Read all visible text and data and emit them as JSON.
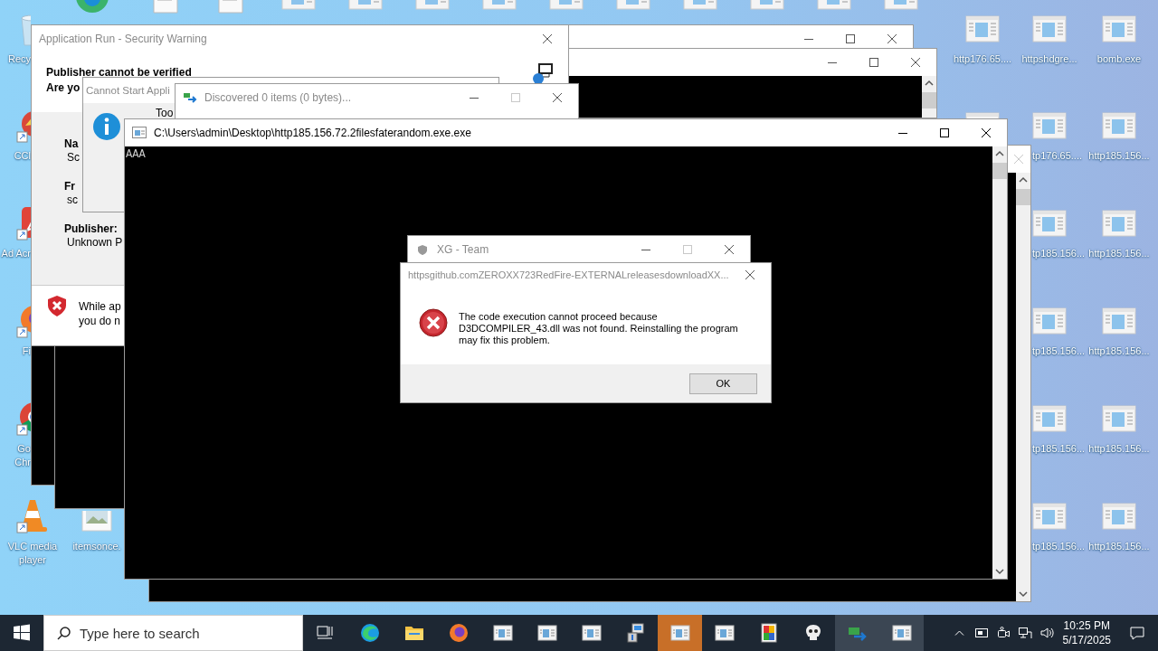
{
  "desktop": {
    "icons": [
      {
        "kind": "recycle",
        "label": "Recy"
      },
      {
        "kind": "browser"
      },
      {
        "kind": "doc"
      },
      {
        "kind": "doc"
      },
      {
        "kind": "exe"
      },
      {
        "kind": "exe"
      },
      {
        "kind": "exe"
      },
      {
        "kind": "exe"
      },
      {
        "kind": "exe"
      },
      {
        "kind": "exe"
      },
      {
        "kind": "exe"
      },
      {
        "kind": "exe"
      },
      {
        "kind": "exe"
      },
      {
        "kind": "exe"
      },
      {
        "kind": "exe",
        "label": "http176.65...."
      },
      {
        "kind": "exe",
        "label": "httpshdgre..."
      },
      {
        "kind": "exe",
        "label": "bomb.exe"
      },
      {
        "kind": "shortcut",
        "label": "CCl"
      },
      {
        "kind": "exe"
      },
      {
        "kind": "exe",
        "label": "tp176.65...."
      },
      {
        "kind": "exe",
        "label": "http185.156..."
      },
      {
        "kind": "acrobat",
        "label": "Ad Acr"
      },
      {
        "kind": "exe",
        "label": "tp185.156..."
      },
      {
        "kind": "exe",
        "label": "http185.156..."
      },
      {
        "kind": "firefox",
        "label": "Fi"
      },
      {
        "kind": "exe",
        "label": "tp185.156..."
      },
      {
        "kind": "exe",
        "label": "http185.156..."
      },
      {
        "kind": "chrome",
        "label": "Go Chr"
      },
      {
        "kind": "exe",
        "label": "tp185.156..."
      },
      {
        "kind": "exe",
        "label": "http185.156..."
      },
      {
        "kind": "vlc",
        "label": "VLC media player"
      },
      {
        "kind": "image",
        "label": "itemsonce."
      },
      {
        "kind": "exe",
        "label": "tp185.156..."
      },
      {
        "kind": "exe",
        "label": "http185.156..."
      }
    ]
  },
  "windows": [
    {
      "kind": "blank",
      "active": false,
      "buttons": [
        {
          "kind": "minimize",
          "disabled": false
        },
        {
          "kind": "maximize",
          "disabled": false
        },
        {
          "kind": "close",
          "disabled": false
        }
      ]
    },
    {
      "kind": "console",
      "active": false,
      "buttons": [
        {
          "kind": "minimize",
          "disabled": false
        },
        {
          "kind": "maximize",
          "disabled": false
        },
        {
          "kind": "close",
          "disabled": false
        }
      ]
    },
    {
      "kind": "console"
    },
    {
      "kind": "console"
    },
    {
      "kind": "security_warning",
      "title": "Application Run - Security Warning",
      "active": false,
      "buttons": [
        {
          "kind": "close",
          "disabled": false
        }
      ],
      "heading": [
        "Publisher cannot be verified",
        "Are yo"
      ],
      "fields": [
        {
          "label": "Na",
          "value": "Sc"
        },
        {
          "label": "Fr",
          "value": "sc"
        },
        {
          "label": "Publisher:",
          "value": "Unknown P"
        }
      ],
      "footer": "While ap\nyou do n"
    },
    {
      "kind": "message",
      "title": "Cannot Start Appli",
      "active": false,
      "text": "Too"
    },
    {
      "kind": "progress",
      "title": "Discovered 0 items (0 bytes)...",
      "active": false,
      "buttons": [
        {
          "kind": "minimize",
          "disabled": false
        },
        {
          "kind": "maximize",
          "disabled": true
        },
        {
          "kind": "close",
          "disabled": false
        }
      ]
    },
    {
      "kind": "console",
      "active": false,
      "buttons": [
        {
          "kind": "close",
          "disabled": true
        }
      ]
    },
    {
      "kind": "console",
      "title": "C:\\Users\\admin\\Desktop\\http185.156.72.2filesfaterandom.exe.exe",
      "active": true,
      "output": "AAA",
      "buttons": [
        {
          "kind": "minimize",
          "disabled": false
        },
        {
          "kind": "maximize",
          "disabled": false
        },
        {
          "kind": "close",
          "disabled": false
        }
      ]
    },
    {
      "kind": "titled",
      "title": "XG - Team",
      "active": false,
      "buttons": [
        {
          "kind": "minimize",
          "disabled": false
        },
        {
          "kind": "maximize",
          "disabled": true
        },
        {
          "kind": "close",
          "disabled": false
        }
      ]
    },
    {
      "kind": "error",
      "title": "httpsgithub.comZEROXX723RedFire-EXTERNALreleasesdownloadXX...",
      "active": false,
      "buttons": [
        {
          "kind": "close",
          "disabled": false
        }
      ],
      "message": "The code execution cannot proceed because\nD3DCOMPILER_43.dll was not found. Reinstalling the program\nmay fix this problem.",
      "ok": "OK"
    }
  ],
  "taskbar": {
    "search": {
      "placeholder": "Type here to search"
    },
    "apps": [
      {
        "kind": "taskview",
        "active": false,
        "flashing": false
      },
      {
        "kind": "edge",
        "active": false,
        "flashing": false
      },
      {
        "kind": "folder",
        "active": false,
        "flashing": false
      },
      {
        "kind": "firefox",
        "active": false,
        "flashing": false
      },
      {
        "kind": "window",
        "active": false,
        "flashing": false
      },
      {
        "kind": "window",
        "active": false,
        "flashing": false
      },
      {
        "kind": "window",
        "active": false,
        "flashing": false
      },
      {
        "kind": "installer",
        "active": false,
        "flashing": false
      },
      {
        "kind": "window",
        "active": false,
        "flashing": true
      },
      {
        "kind": "window",
        "active": false,
        "flashing": false
      },
      {
        "kind": "palette",
        "active": false,
        "flashing": false
      },
      {
        "kind": "skull",
        "active": false,
        "flashing": false
      },
      {
        "kind": "transfer",
        "active": true,
        "flashing": false
      },
      {
        "kind": "window",
        "active": true,
        "flashing": false
      }
    ],
    "tray": {
      "icons": [
        {
          "kind": "chevron"
        },
        {
          "kind": "card"
        },
        {
          "kind": "camera"
        },
        {
          "kind": "network"
        },
        {
          "kind": "volume"
        }
      ],
      "time": "10:25 PM",
      "date": "5/17/2025"
    }
  }
}
